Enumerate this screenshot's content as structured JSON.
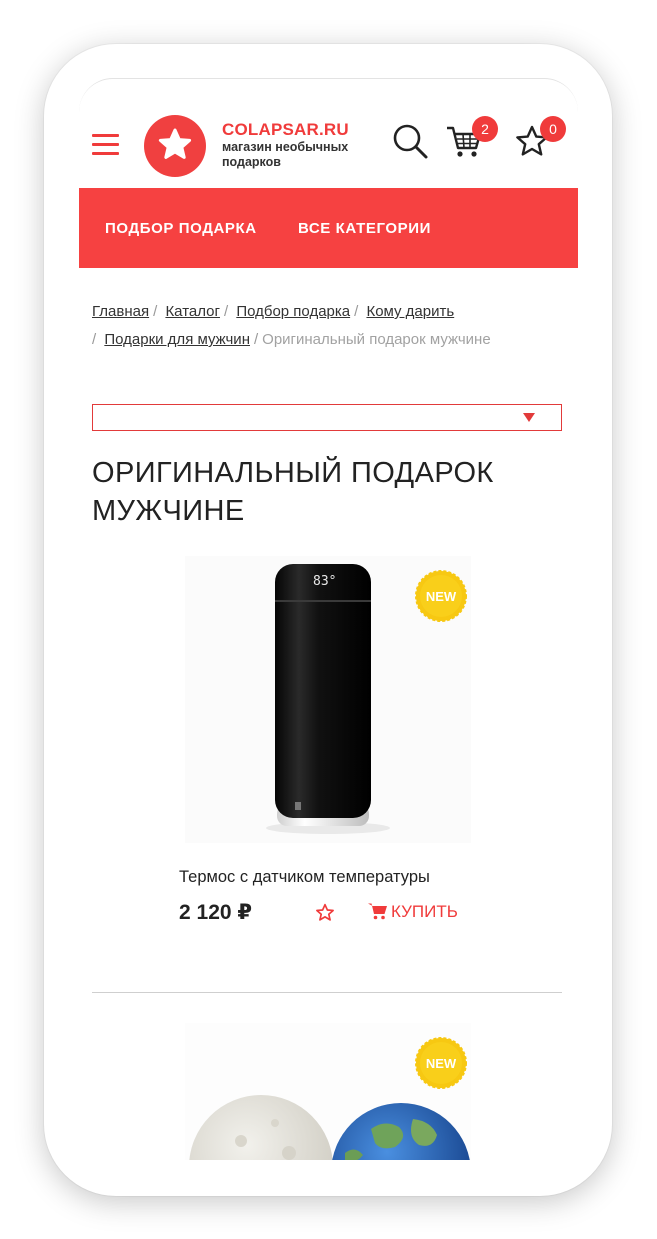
{
  "header": {
    "brand_name": "COLAPSAR.RU",
    "brand_tagline": "магазин необычных подарков",
    "cart_count": "2",
    "favorites_count": "0"
  },
  "nav": {
    "items": [
      {
        "label": "ПОДБОР ПОДАРКА"
      },
      {
        "label": "ВСЕ КАТЕГОРИИ"
      }
    ]
  },
  "breadcrumbs": {
    "items": [
      {
        "label": "Главная"
      },
      {
        "label": "Каталог"
      },
      {
        "label": "Подбор подарка"
      },
      {
        "label": "Кому дарить"
      },
      {
        "label": "Подарки для мужчин"
      }
    ],
    "current": "Оригинальный подарок мужчине"
  },
  "filter_select": {
    "value": ""
  },
  "page": {
    "title": "ОРИГИНАЛЬНЫЙ ПОДАРОК МУЖЧИНЕ"
  },
  "products": [
    {
      "name": "Термос с датчиком температуры",
      "price": "2 120 ₽",
      "badge": "NEW",
      "buy_label": "КУПИТЬ",
      "display_reading": "83°"
    },
    {
      "name": "",
      "badge": "NEW"
    }
  ],
  "colors": {
    "brand_red": "#f03b3b",
    "nav_red": "#f64141",
    "badge_yellow": "#f7c812"
  },
  "icons": [
    "menu-icon",
    "star-logo-icon",
    "search-icon",
    "cart-icon",
    "favorites-star-icon",
    "cart-small-icon",
    "dropdown-arrow-icon"
  ]
}
